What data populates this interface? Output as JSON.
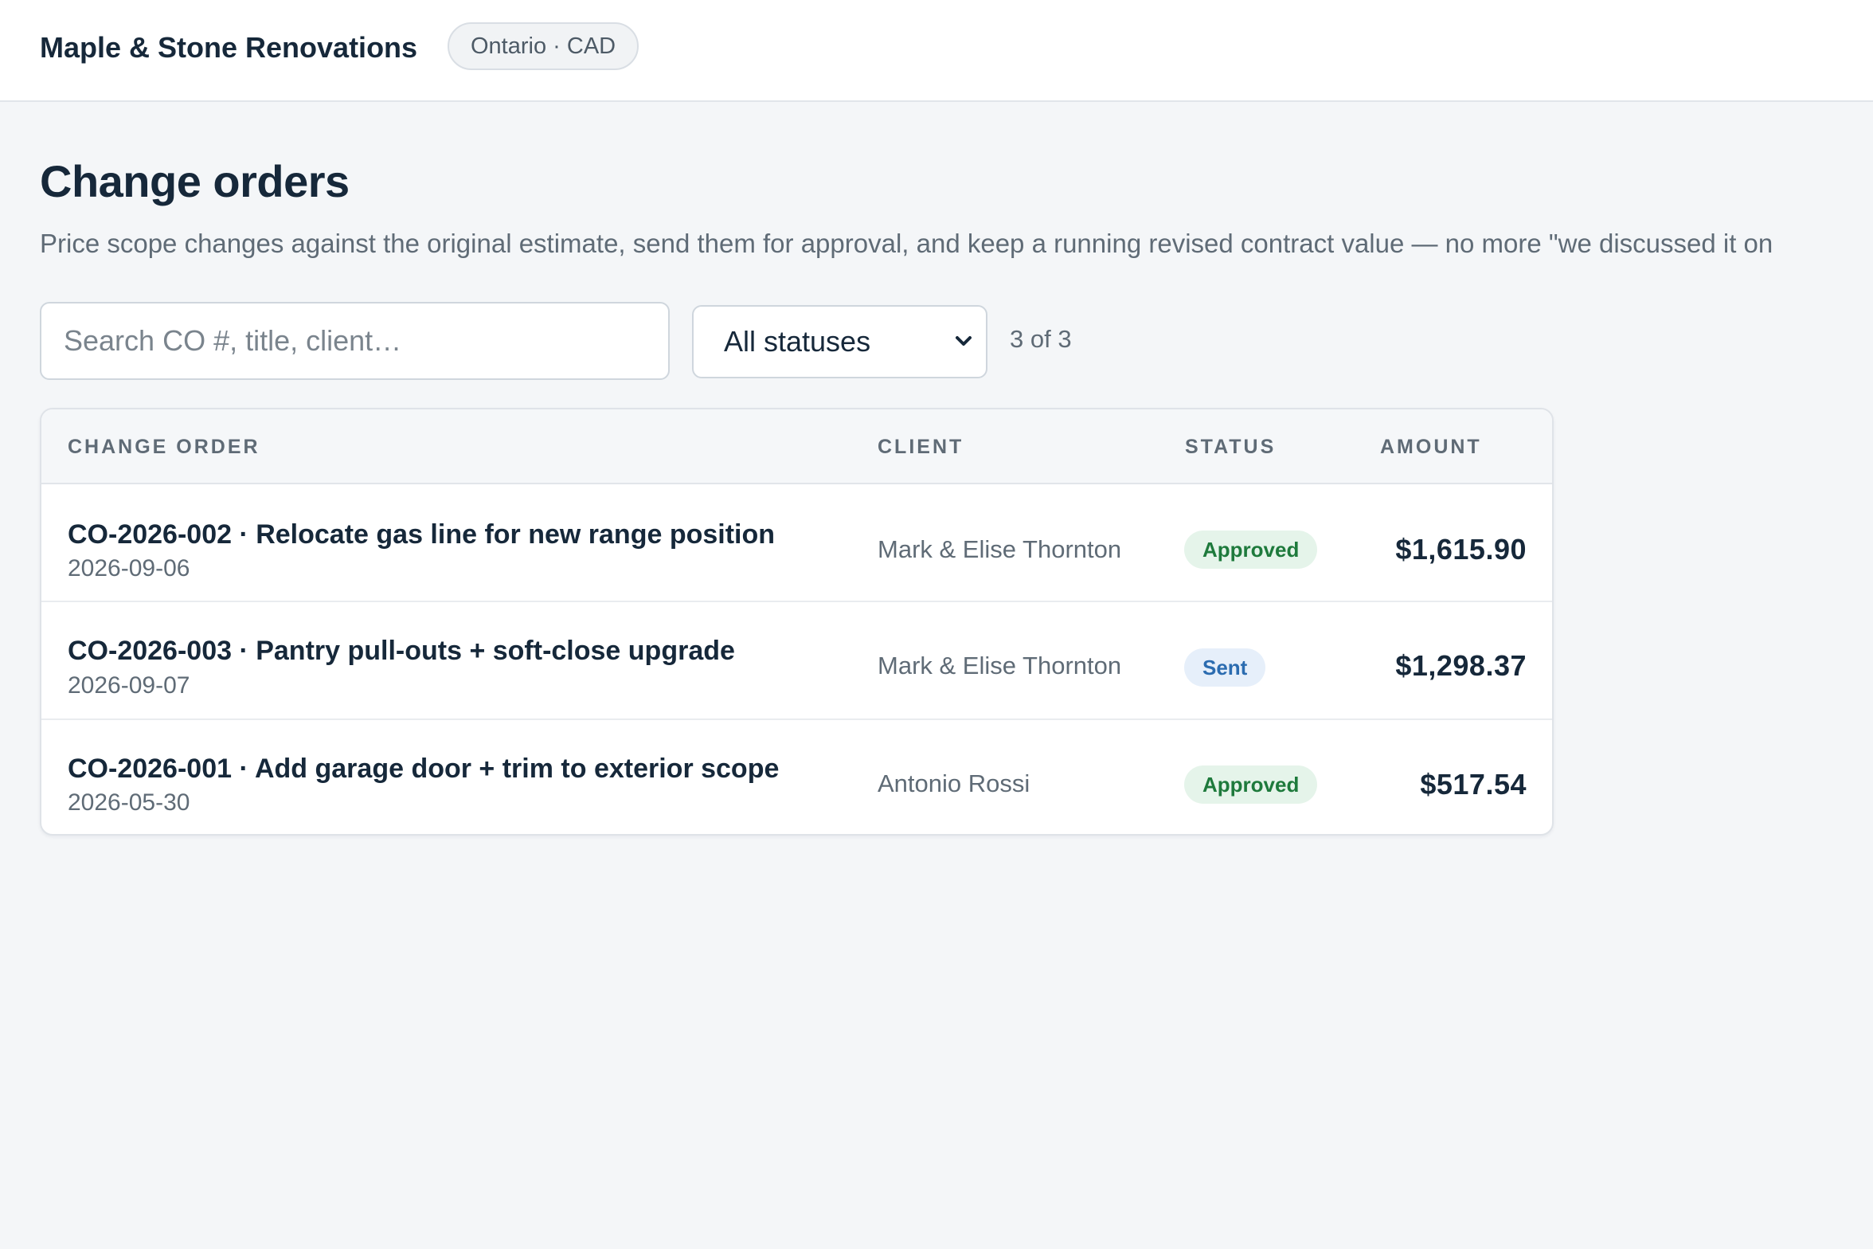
{
  "header": {
    "brand": "Maple & Stone Renovations",
    "region": "Ontario · CAD"
  },
  "page": {
    "title": "Change orders",
    "description": "Price scope changes against the original estimate, send them for approval, and keep a running revised contract value — no more \"we discussed it on"
  },
  "filters": {
    "search_placeholder": "Search CO #, title, client…",
    "status_selected": "All statuses",
    "count": "3 of 3"
  },
  "table": {
    "columns": [
      "CHANGE ORDER",
      "CLIENT",
      "STATUS",
      "AMOUNT"
    ],
    "rows": [
      {
        "title": "CO-2026-002 · Relocate gas line for new range position",
        "date": "2026-09-06",
        "client": "Mark & Elise Thornton",
        "status": "Approved",
        "amount": "$1,615.90"
      },
      {
        "title": "CO-2026-003 · Pantry pull-outs + soft-close upgrade",
        "date": "2026-09-07",
        "client": "Mark & Elise Thornton",
        "status": "Sent",
        "amount": "$1,298.37"
      },
      {
        "title": "CO-2026-001 · Add garage door + trim to exterior scope",
        "date": "2026-05-30",
        "client": "Antonio Rossi",
        "status": "Approved",
        "amount": "$517.54"
      }
    ]
  },
  "colors": {
    "approved_bg": "#e5f4ea",
    "approved_text": "#1e7a3c",
    "sent_bg": "#e6effa",
    "sent_text": "#2b6cb0"
  }
}
